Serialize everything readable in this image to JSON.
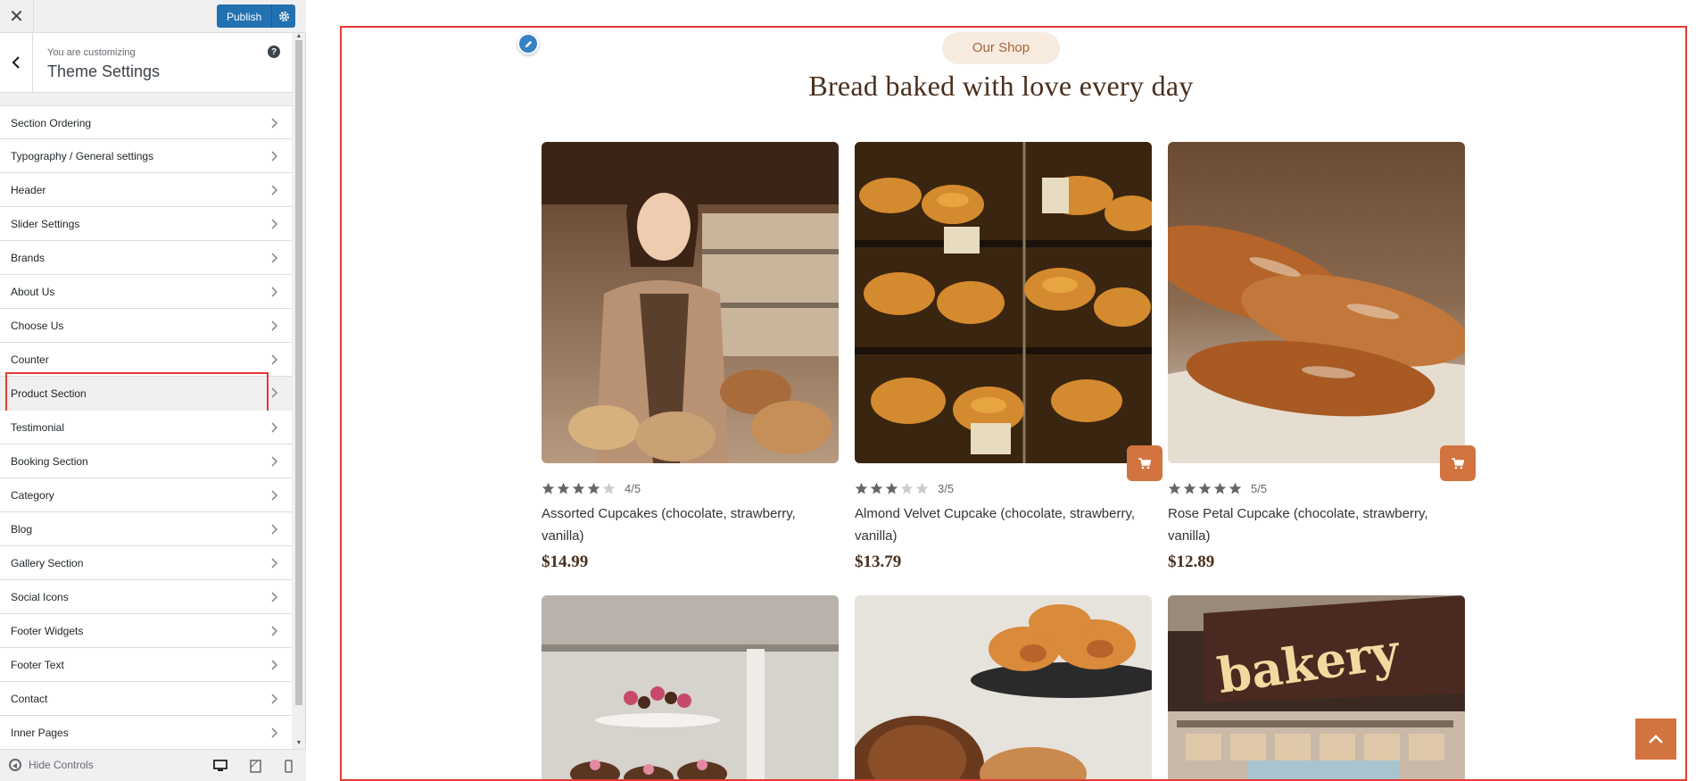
{
  "topbar": {
    "close_label": "✕",
    "publish_label": "Publish"
  },
  "info": {
    "subtitle": "You are customizing",
    "title": "Theme Settings",
    "help": "?"
  },
  "menu": {
    "items": [
      {
        "label": "Section Ordering"
      },
      {
        "label": "Typography / General settings"
      },
      {
        "label": "Header"
      },
      {
        "label": "Slider Settings"
      },
      {
        "label": "Brands"
      },
      {
        "label": "About Us"
      },
      {
        "label": "Choose Us"
      },
      {
        "label": "Counter"
      },
      {
        "label": "Product Section"
      },
      {
        "label": "Testimonial"
      },
      {
        "label": "Booking Section"
      },
      {
        "label": "Category"
      },
      {
        "label": "Blog"
      },
      {
        "label": "Gallery Section"
      },
      {
        "label": "Social Icons"
      },
      {
        "label": "Footer Widgets"
      },
      {
        "label": "Footer Text"
      },
      {
        "label": "Contact"
      },
      {
        "label": "Inner Pages"
      }
    ]
  },
  "footer": {
    "hide_controls": "Hide Controls"
  },
  "preview": {
    "badge": "Our Shop",
    "heading": "Bread baked with love every day",
    "products": [
      {
        "stars": 4,
        "rating": "4/5",
        "name": "Assorted Cupcakes (chocolate, strawberry, vanilla)",
        "price": "$14.99"
      },
      {
        "stars": 3,
        "rating": "3/5",
        "name": "Almond Velvet Cupcake (chocolate, strawberry, vanilla)",
        "price": "$13.79"
      },
      {
        "stars": 5,
        "rating": "5/5",
        "name": "Rose Petal Cupcake (chocolate, strawberry, vanilla)",
        "price": "$12.89"
      }
    ],
    "bakery_sign": "bakery"
  },
  "colors": {
    "accent": "#d3733f",
    "wp_blue": "#2271b1",
    "highlight_red": "#e53935",
    "heading_brown": "#4a2e1c"
  }
}
